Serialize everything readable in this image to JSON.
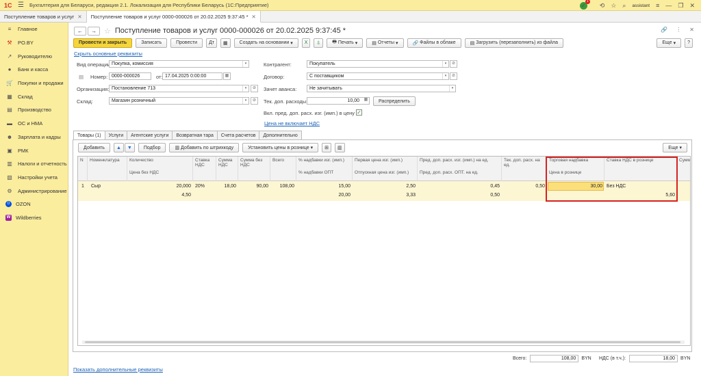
{
  "app": {
    "logo": "1С",
    "title": "Бухгалтерия для Беларуси, редакция 2.1. Локализация для Республики Беларусь",
    "platform": "(1С:Предприятие)",
    "notify_count": "1",
    "user": "assistant"
  },
  "open_tabs": [
    {
      "label": "Поступление товаров и услуг"
    },
    {
      "label": "Поступление товаров и услуг 0000-000026 от 20.02.2025 9:37:45 *"
    }
  ],
  "sidebar": {
    "items": [
      {
        "label": "Главное",
        "icon": "≡"
      },
      {
        "label": "PO.BY",
        "icon": "⚒"
      },
      {
        "label": "Руководителю",
        "icon": "↗"
      },
      {
        "label": "Банк и касса",
        "icon": "●"
      },
      {
        "label": "Покупки и продажи",
        "icon": "🛒"
      },
      {
        "label": "Склад",
        "icon": "▦"
      },
      {
        "label": "Производство",
        "icon": "▤"
      },
      {
        "label": "ОС и НМА",
        "icon": "▬"
      },
      {
        "label": "Зарплата и кадры",
        "icon": "☻"
      },
      {
        "label": "РМК",
        "icon": "▣"
      },
      {
        "label": "Налоги и отчетность",
        "icon": "▥"
      },
      {
        "label": "Настройки учета",
        "icon": "▧"
      },
      {
        "label": "Администрирование",
        "icon": "⚙"
      },
      {
        "label": "OZON",
        "icon": "O"
      },
      {
        "label": "Wildberries",
        "icon": "W"
      }
    ]
  },
  "doc": {
    "title": "Поступление товаров и услуг 0000-000026 от 20.02.2025 9:37:45 *"
  },
  "toolbar": {
    "post_close": "Провести и закрыть",
    "save": "Записать",
    "post": "Провести",
    "create_based": "Создать на основании",
    "print": "Печать",
    "reports": "Отчеты",
    "files": "Файлы в облаке",
    "load": "Загрузить (перезаполнить) из файла",
    "more": "Еще"
  },
  "form": {
    "hide_link": "Скрыть основные реквизиты",
    "op_type_label": "Вид операции:",
    "op_type": "Покупка, комиссия",
    "number_label": "Номер:",
    "number": "0000-000026",
    "date_label": "от:",
    "date": "17.04.2025  0:00:00",
    "org_label": "Организация:",
    "org": "Постановление 713",
    "store_label": "Склад:",
    "store": "Магазин розничный",
    "contractor_label": "Контрагент:",
    "contractor": "Покупатель",
    "contract_label": "Договор:",
    "contract": "С поставщиком",
    "advance_label": "Зачет аванса:",
    "advance": "Не зачитывать",
    "expenses_label": "Тек. доп. расходы:",
    "expenses": "10,00",
    "distribute": "Распределить",
    "incl_label": "Вкл. пред. доп. расх. изг. (имп.) в цену :",
    "vat_link": "Цена не включает НДС"
  },
  "inner_tabs": [
    "Товары (1)",
    "Услуги",
    "Агентские услуги",
    "Возвратная тара",
    "Счета расчетов",
    "Дополнительно"
  ],
  "table_toolbar": {
    "add": "Добавить",
    "select": "Подбор",
    "barcode": "Добавить по штрихкоду",
    "set_prices": "Установить цены в рознице",
    "more": "Еще"
  },
  "columns": {
    "n": "N",
    "item": "Номенклатура",
    "qty": "Количество",
    "price_no_vat": "Цена без НДС",
    "vat_rate": "Ставка НДС",
    "vat_sum": "Сумма НДС",
    "sum_no_vat": "Сумма без НДС",
    "total": "Всего",
    "markup_mfr": "% надбавки изг. (имп.)",
    "markup_opt": "% надбавки ОПТ",
    "first_price": "Первая цена изг. (имп.)",
    "release_price": "Отпускная цена изг. (имп.)",
    "prev_exp": "Пред. доп. расх. изг. (имп.) на ед.",
    "prev_exp_opt": "Пред. доп. расх. ОПТ. на ед.",
    "cur_exp": "Тек. доп. расх. на ед.",
    "trade_markup": "Торговая надбавка",
    "retail_price": "Цена в рознице",
    "retail_vat": "Ставка НДС в рознице",
    "sum_trunc": "Сумм"
  },
  "row": {
    "n": "1",
    "item": "Сыр",
    "qty": "20,000",
    "price": "4,50",
    "vat_rate": "20%",
    "vat_sum": "18,00",
    "sum_no_vat": "90,00",
    "total": "108,00",
    "markup_mfr": "15,00",
    "markup_opt": "20,00",
    "first_price": "2,50",
    "release_price": "3,33",
    "prev_exp": "0,45",
    "prev_exp_opt": "0,50",
    "cur_exp": "0,50",
    "trade_markup": "30,00",
    "retail_price": "5,60",
    "retail_vat": "Без НДС"
  },
  "totals": {
    "total_label": "Всего:",
    "total": "108,00",
    "currency": "BYN",
    "vat_label": "НДС (в т.ч.):",
    "vat": "18,00",
    "currency2": "BYN"
  },
  "bottom_link": "Показать дополнительные реквизиты"
}
